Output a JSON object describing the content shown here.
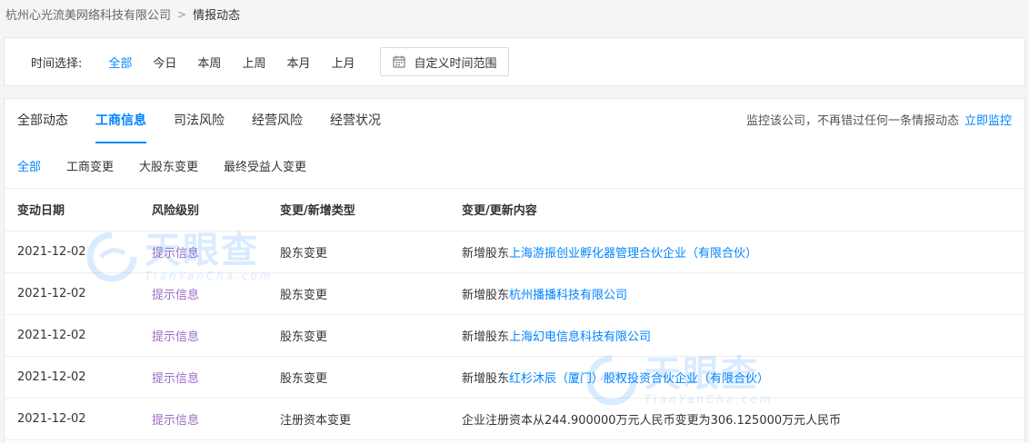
{
  "breadcrumb": {
    "company": "杭州心光流美网络科技有限公司",
    "separator": ">",
    "current": "情报动态"
  },
  "filter": {
    "label": "时间选择:",
    "options": [
      "全部",
      "今日",
      "本周",
      "上周",
      "本月",
      "上月"
    ],
    "active_index": 0,
    "custom_range_label": "自定义时间范围"
  },
  "tabs": {
    "items": [
      "全部动态",
      "工商信息",
      "司法风险",
      "经营风险",
      "经营状况"
    ],
    "active_index": 1
  },
  "monitor": {
    "text": "监控该公司，不再错过任何一条情报动态",
    "link": "立即监控"
  },
  "subtabs": {
    "items": [
      "全部",
      "工商变更",
      "大股东变更",
      "最终受益人变更"
    ],
    "active_index": 0
  },
  "table": {
    "headers": [
      "变动日期",
      "风险级别",
      "变更/新增类型",
      "变更/更新内容"
    ],
    "rows": [
      {
        "date": "2021-12-02",
        "risk": "提示信息",
        "type": "股东变更",
        "prefix": "新增股东",
        "link": "上海游振创业孵化器管理合伙企业（有限合伙）",
        "text": ""
      },
      {
        "date": "2021-12-02",
        "risk": "提示信息",
        "type": "股东变更",
        "prefix": "新增股东",
        "link": "杭州播播科技有限公司",
        "text": ""
      },
      {
        "date": "2021-12-02",
        "risk": "提示信息",
        "type": "股东变更",
        "prefix": "新增股东",
        "link": "上海幻电信息科技有限公司",
        "text": ""
      },
      {
        "date": "2021-12-02",
        "risk": "提示信息",
        "type": "股东变更",
        "prefix": "新增股东",
        "link": "红杉沐辰（厦门）股权投资合伙企业（有限合伙）",
        "text": ""
      },
      {
        "date": "2021-12-02",
        "risk": "提示信息",
        "type": "注册资本变更",
        "prefix": "",
        "link": "",
        "text": "企业注册资本从244.900000万元人民币变更为306.125000万元人民币"
      }
    ]
  },
  "watermark": {
    "big": "天眼查",
    "small": "TianYanCha.com"
  },
  "colors": {
    "accent": "#0084ff",
    "risk_notice": "#9b6bc8"
  },
  "icons": {
    "custom_range": "calendar-icon",
    "watermark": "tianyancha-logo-icon"
  }
}
